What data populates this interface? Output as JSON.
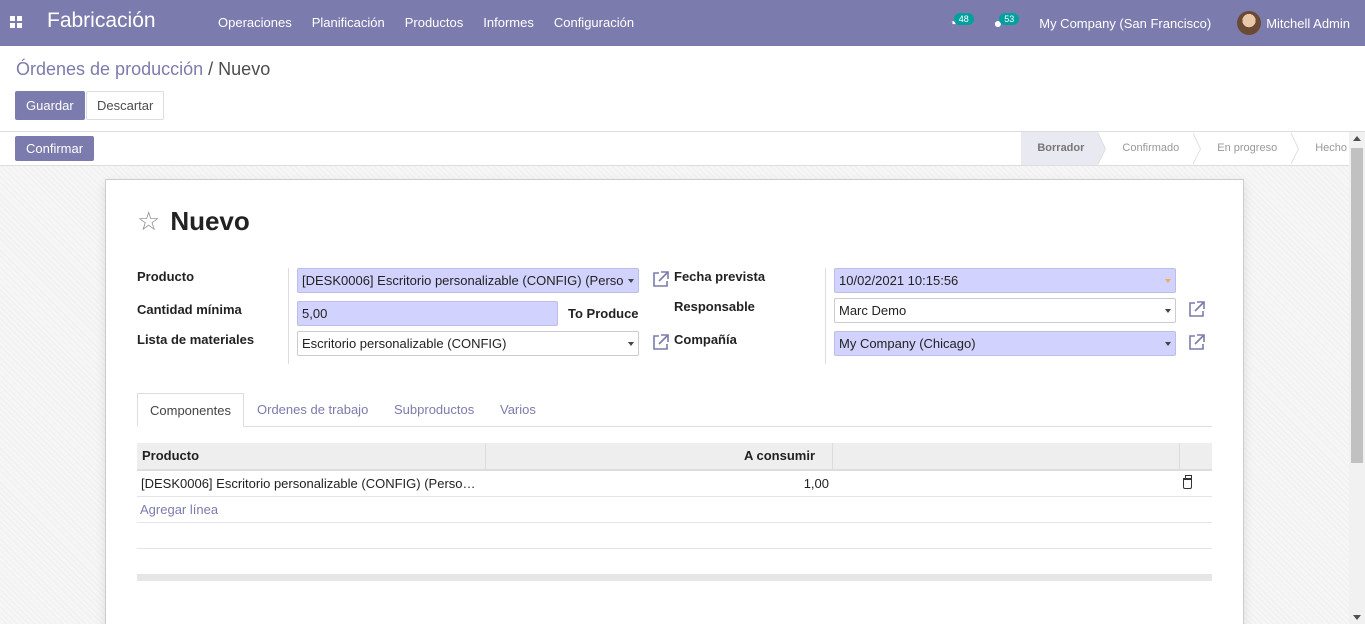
{
  "navbar": {
    "app_name": "Fabricación",
    "menu": [
      "Operaciones",
      "Planificación",
      "Productos",
      "Informes",
      "Configuración"
    ],
    "activity_count": "48",
    "messages_count": "53",
    "company": "My Company (San Francisco)",
    "user": "Mitchell Admin",
    "color": "#7c7bad"
  },
  "breadcrumb": {
    "parent": "Órdenes de producción",
    "separator": "/",
    "current": "Nuevo"
  },
  "buttons": {
    "save": "Guardar",
    "discard": "Descartar",
    "confirm": "Confirmar"
  },
  "stages": [
    "Borrador",
    "Confirmado",
    "En progreso",
    "Hecho"
  ],
  "active_stage": "Borrador",
  "form": {
    "title": "Nuevo",
    "product_label": "Producto",
    "product_value": "[DESK0006] Escritorio personalizable (CONFIG) (Perso",
    "qty_label": "Cantidad mínima",
    "qty_value": "5,00",
    "qty_suffix": "To Produce",
    "bom_label": "Lista de materiales",
    "bom_value": "Escritorio personalizable (CONFIG)",
    "date_label": "Fecha prevista",
    "date_value": "10/02/2021 10:15:56",
    "responsible_label": "Responsable",
    "responsible_value": "Marc Demo",
    "company_label": "Compañía",
    "company_value": "My Company (Chicago)"
  },
  "tabs": [
    "Componentes",
    "Ordenes de trabajo",
    "Subproductos",
    "Varios"
  ],
  "table": {
    "headers": [
      "Producto",
      "A consumir"
    ],
    "rows": [
      {
        "product": "[DESK0006] Escritorio personalizable (CONFIG) (Perso…",
        "qty": "1,00"
      }
    ],
    "add_line": "Agregar línea"
  }
}
